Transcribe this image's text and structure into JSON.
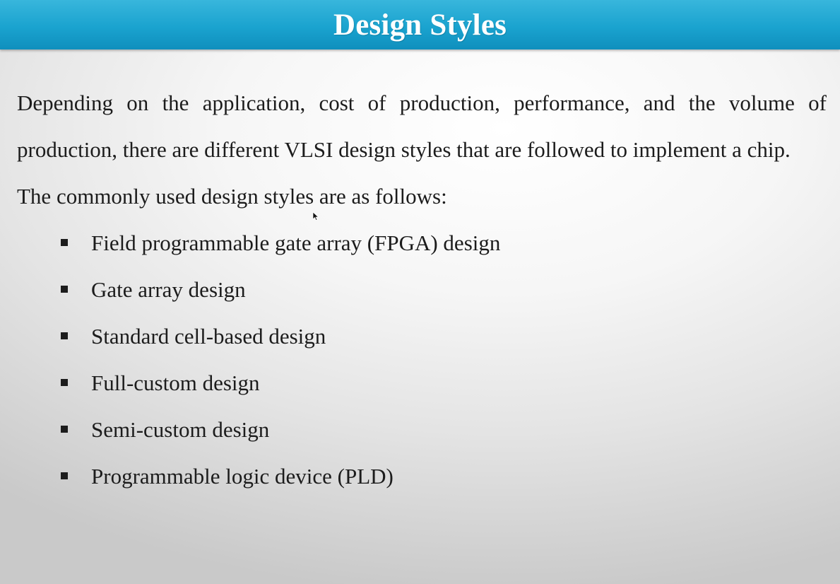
{
  "slide": {
    "title": "Design Styles",
    "intro": "Depending on the application, cost of production, performance, and the volume of production, there are different VLSI design styles that are followed to implement a chip.",
    "lead": "The commonly used design styles are as follows:",
    "items": [
      "Field programmable gate array (FPGA) design",
      "Gate array design",
      "Standard cell-based design",
      "Full-custom design",
      "Semi-custom design",
      "Programmable logic device (PLD)"
    ]
  },
  "colors": {
    "title_bar": "#1aa3cf",
    "title_text": "#ffffff",
    "body_text": "#1c1c1c"
  },
  "icons": {
    "bullet": "square-bullet-icon",
    "cursor": "mouse-pointer-icon"
  }
}
